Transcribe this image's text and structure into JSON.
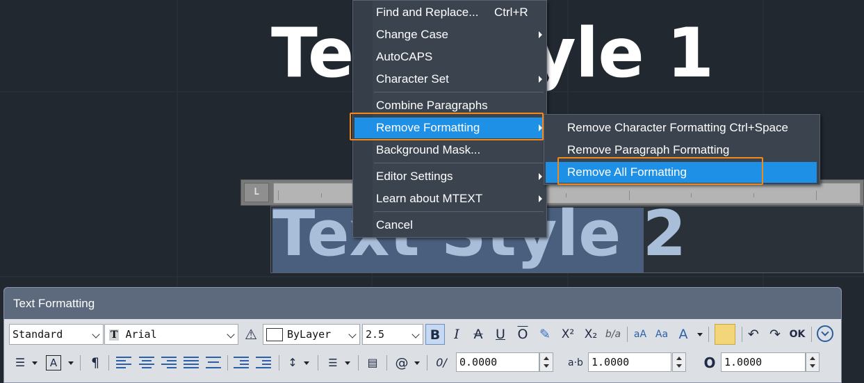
{
  "canvas": {
    "text1": "Text Style 1",
    "text2": "Text Style 2",
    "ruler_corner": "L"
  },
  "context_menu": {
    "items": [
      {
        "label": "Find and Replace...",
        "shortcut": "Ctrl+R"
      },
      {
        "label": "Change Case",
        "submenu": true
      },
      {
        "label": "AutoCAPS"
      },
      {
        "label": "Character Set",
        "submenu": true
      },
      {
        "label": "Combine Paragraphs"
      },
      {
        "label": "Remove Formatting",
        "submenu": true,
        "highlighted": true
      },
      {
        "label": "Background Mask..."
      },
      {
        "label": "Editor Settings",
        "submenu": true
      },
      {
        "label": "Learn about MTEXT",
        "submenu": true
      },
      {
        "label": "Cancel"
      }
    ]
  },
  "submenu": {
    "items": [
      {
        "label": "Remove Character Formatting Ctrl+Space"
      },
      {
        "label": "Remove Paragraph Formatting"
      },
      {
        "label": "Remove All Formatting",
        "highlighted": true
      }
    ]
  },
  "toolbar": {
    "title": "Text Formatting",
    "style": "Standard",
    "font": "Arial",
    "color": "ByLayer",
    "height": "2.5",
    "oblique_angle": "0.0000",
    "tracking": "1.0000",
    "width_factor": "1.0000",
    "tracking_label": "a·b",
    "ok_label": "OK",
    "bold": "B",
    "italic": "I",
    "strike": "A",
    "underline": "U",
    "overline": "O",
    "superscript": "X²",
    "subscript": "X₂",
    "stack": "b/a",
    "at_symbol": "@",
    "oblique_icon": "0/"
  },
  "colors": {
    "menu_bg": "#3b434f",
    "highlight": "#1e90e6",
    "callout": "#f08a1c",
    "canvas_bg": "#212830"
  }
}
